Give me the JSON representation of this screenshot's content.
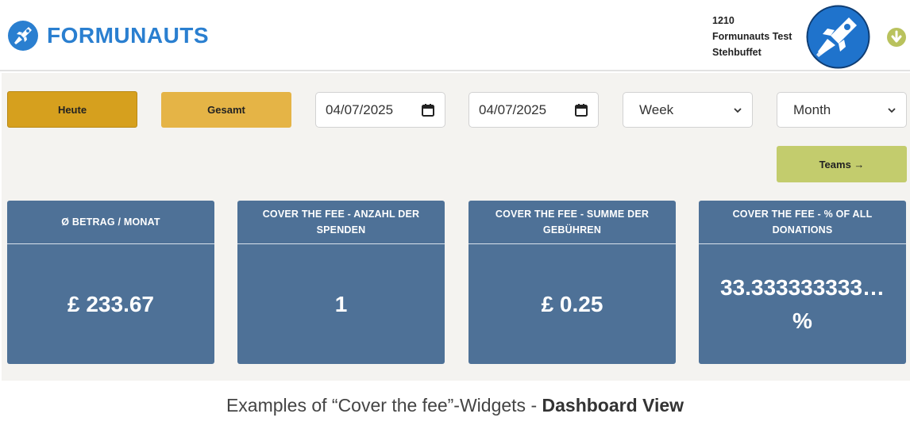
{
  "brand": {
    "name": "FORMUNAUTS",
    "color": "#2a7fd0"
  },
  "user": {
    "id": "1210",
    "line1": "Formunauts Test",
    "line2": "Stehbuffet"
  },
  "filters": {
    "today_label": "Heute",
    "total_label": "Gesamt",
    "date_from": "04/07/2025",
    "date_to": "04/07/2025",
    "period_select": "Week",
    "range_select": "Month",
    "teams_label": "Teams →"
  },
  "cards": [
    {
      "title": "Ø BETRAG / MONAT",
      "value": "£ 233.67"
    },
    {
      "title": "COVER THE FEE - ANZAHL DER SPENDEN",
      "value": "1"
    },
    {
      "title": "COVER THE FEE - SUMME DER GEBÜHREN",
      "value": "£ 0.25"
    },
    {
      "title": "COVER THE FEE - % OF ALL DONATIONS",
      "value": "33.333333333… %"
    }
  ],
  "caption": {
    "prefix": "Examples of “Cover the fee”-Widgets - ",
    "bold": "Dashboard View"
  },
  "colors": {
    "card_bg": "#4e7197",
    "heute": "#d6a01e",
    "gesamt": "#e5b446",
    "teams": "#c3cc6d",
    "panel": "#f4f3f0"
  },
  "icons": [
    "rocket-logo-icon",
    "rocket-avatar-icon",
    "chevron-down-circle-icon",
    "calendar-icon",
    "chevron-down-icon"
  ]
}
